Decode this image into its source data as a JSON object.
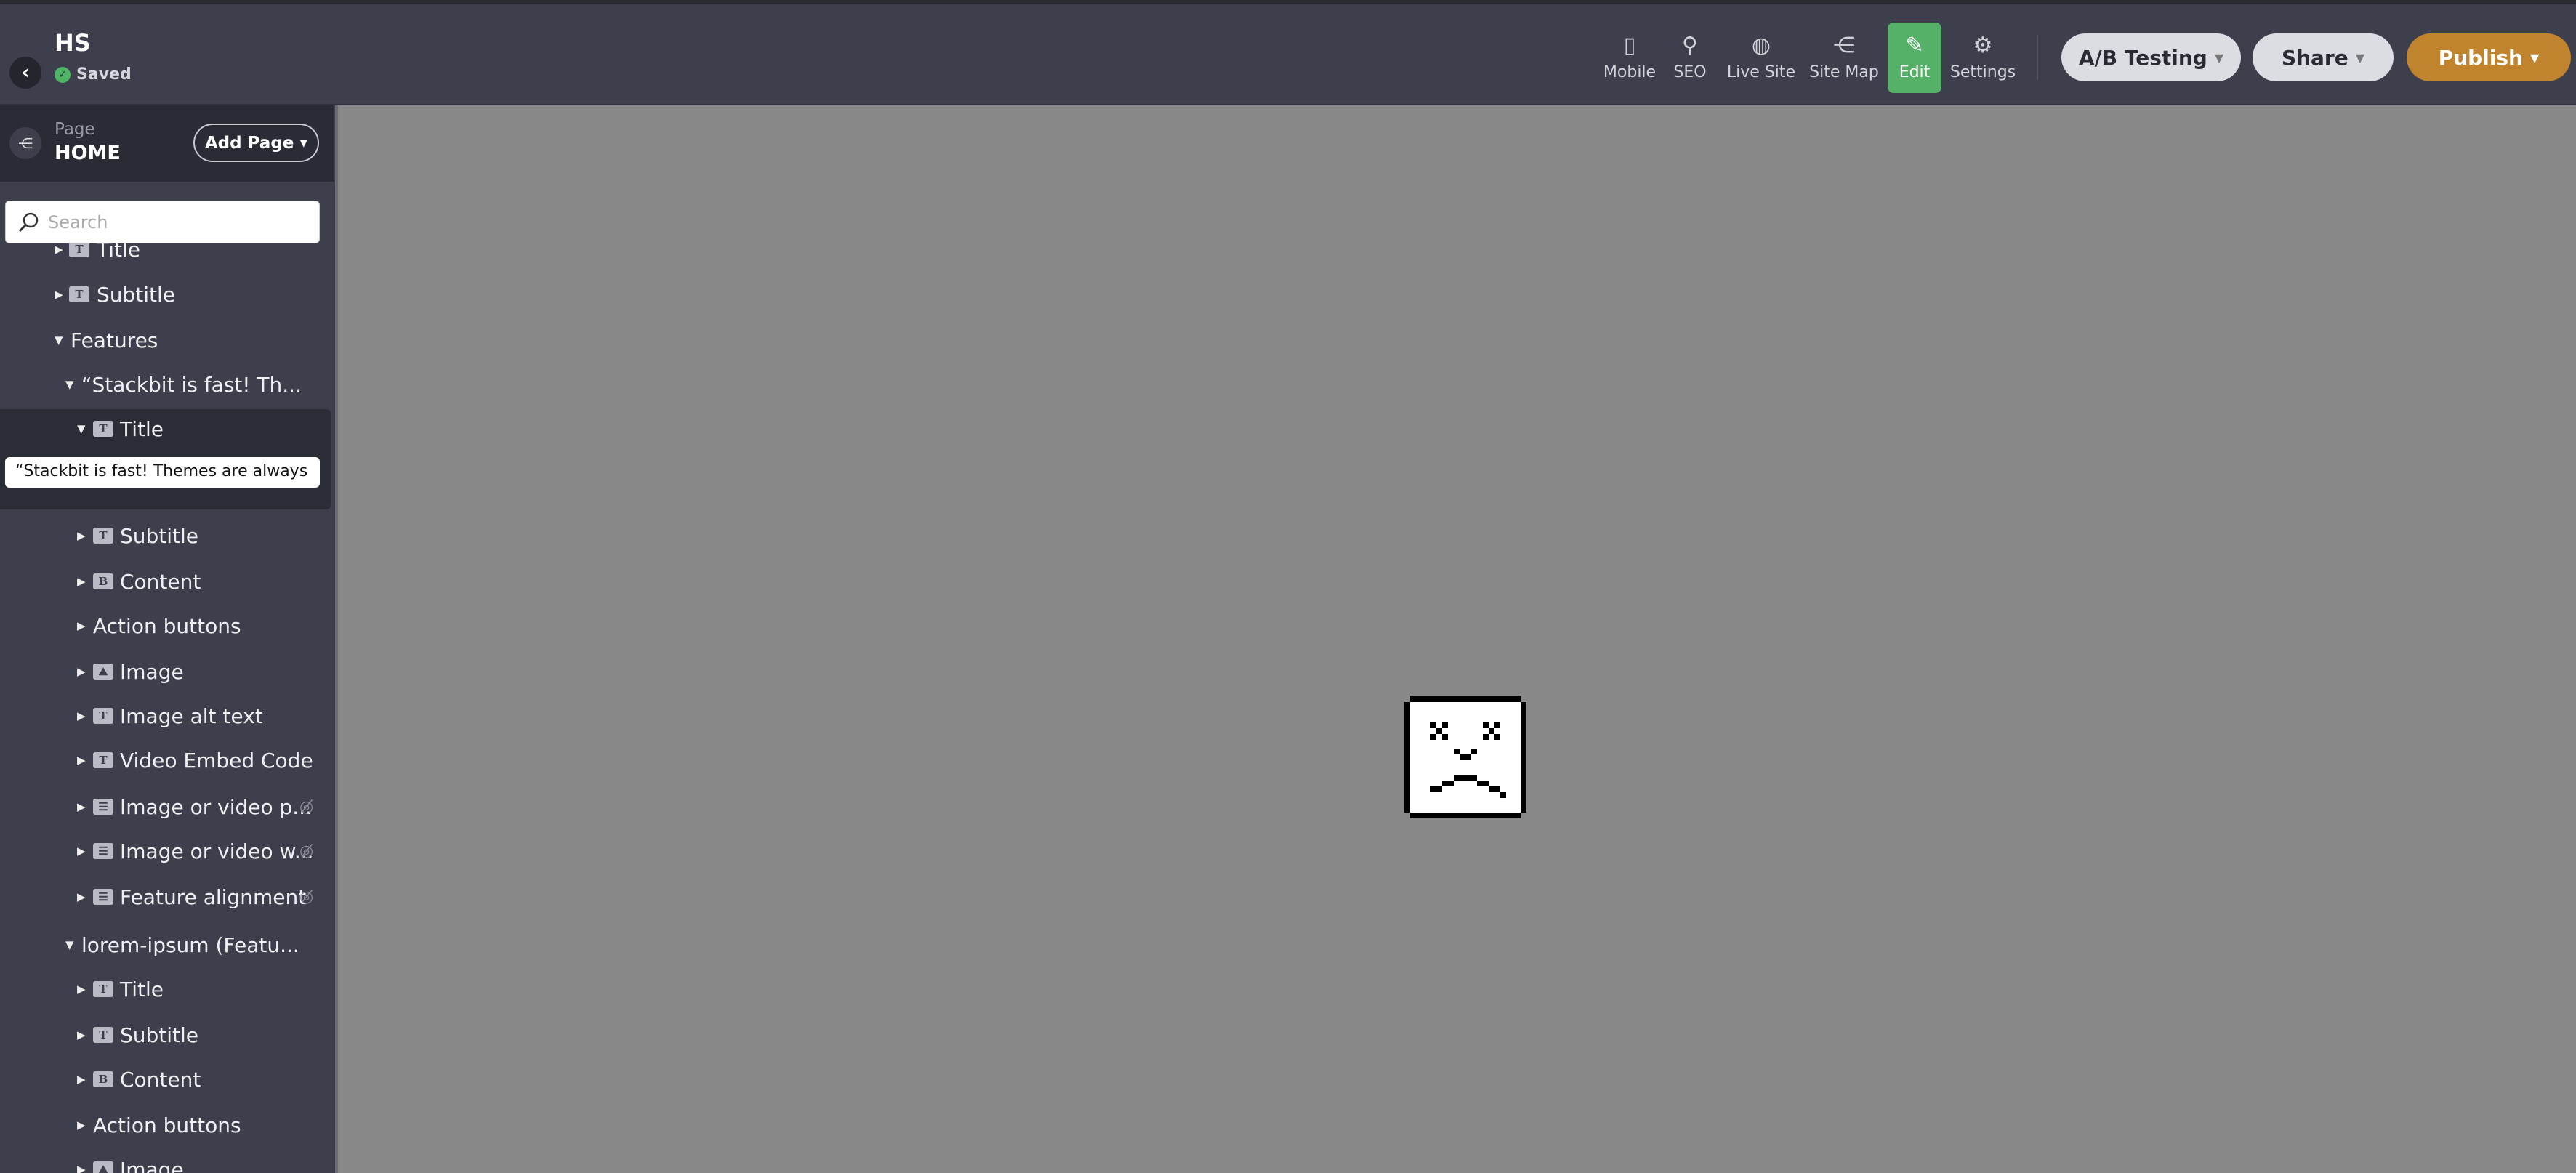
{
  "header": {
    "title": "HS",
    "status": "Saved",
    "nav": [
      {
        "label": "Mobile",
        "icon": "mobile-icon"
      },
      {
        "label": "SEO",
        "icon": "seo-icon"
      },
      {
        "label": "Live Site",
        "icon": "globe-icon"
      },
      {
        "label": "Site Map",
        "icon": "sitemap-icon"
      },
      {
        "label": "Edit",
        "icon": "pencil-icon",
        "active": true
      },
      {
        "label": "Settings",
        "icon": "gear-icon"
      }
    ],
    "ab_testing": "A/B Testing",
    "share": "Share",
    "publish": "Publish",
    "colors": {
      "edit": "#55b168",
      "publish": "#c0832e",
      "saved": "#4fb566"
    }
  },
  "sidebar": {
    "page_label": "Page",
    "page_name": "HOME",
    "add_page": "Add Page",
    "search_placeholder": "Search",
    "selected_value": "“Stackbit is fast! Themes are always",
    "tree": [
      {
        "label": "Title",
        "level": 1,
        "icon": "T",
        "expanded": false
      },
      {
        "label": "Subtitle",
        "level": 1,
        "icon": "T",
        "expanded": false
      },
      {
        "label": "Features",
        "level": 1,
        "icon": null,
        "expanded": true
      },
      {
        "label": "“Stackbit is fast! Th...",
        "level": 2,
        "icon": null,
        "expanded": true
      },
      {
        "label": "Title",
        "level": 3,
        "icon": "T",
        "expanded": true,
        "selected": true
      },
      {
        "label": "Subtitle",
        "level": 3,
        "icon": "T",
        "expanded": false
      },
      {
        "label": "Content",
        "level": 3,
        "icon": "B",
        "expanded": false
      },
      {
        "label": "Action buttons",
        "level": 3,
        "icon": null,
        "expanded": false
      },
      {
        "label": "Image",
        "level": 3,
        "icon": "image",
        "expanded": false
      },
      {
        "label": "Image alt text",
        "level": 3,
        "icon": "T",
        "expanded": false
      },
      {
        "label": "Video Embed Code",
        "level": 3,
        "icon": "T",
        "expanded": false
      },
      {
        "label": "Image or video p...",
        "level": 3,
        "icon": "list",
        "expanded": false,
        "hidden": true
      },
      {
        "label": "Image or video w...",
        "level": 3,
        "icon": "list",
        "expanded": false,
        "hidden": true
      },
      {
        "label": "Feature alignment",
        "level": 3,
        "icon": "list",
        "expanded": false,
        "hidden": true
      },
      {
        "label": "lorem-ipsum (Featu...",
        "level": 2,
        "icon": null,
        "expanded": true
      },
      {
        "label": "Title",
        "level": 3,
        "icon": "T",
        "expanded": false
      },
      {
        "label": "Subtitle",
        "level": 3,
        "icon": "T",
        "expanded": false
      },
      {
        "label": "Content",
        "level": 3,
        "icon": "B",
        "expanded": false
      },
      {
        "label": "Action buttons",
        "level": 3,
        "icon": null,
        "expanded": false
      },
      {
        "label": "Image",
        "level": 3,
        "icon": "image",
        "expanded": false
      }
    ]
  },
  "canvas": {
    "state_icon": "sad-face-error-icon"
  }
}
